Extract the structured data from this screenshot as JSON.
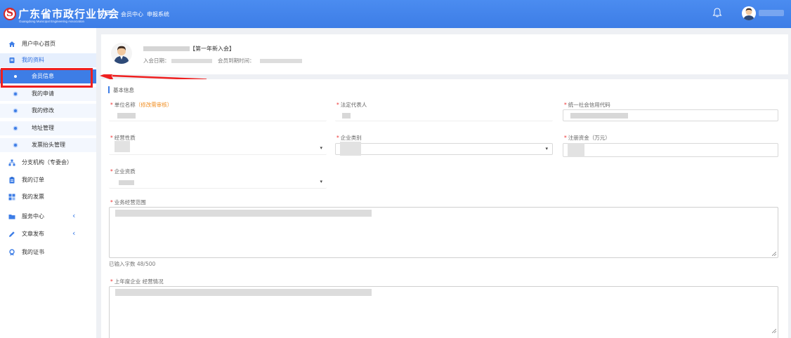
{
  "header": {
    "org_name": "广东省市政行业协会",
    "org_subtitle": "Guangdong Municipal Engineering Association",
    "menu_icon": "hamburger-icon",
    "nav": [
      "会员中心",
      "申报系统"
    ]
  },
  "sidebar": {
    "items": [
      {
        "label": "用户中心首页",
        "icon": "home-icon"
      },
      {
        "label": "我的资料",
        "icon": "profile-icon"
      },
      {
        "label": "会员信息",
        "icon": "dot-icon"
      },
      {
        "label": "我的申请",
        "icon": "dot-icon"
      },
      {
        "label": "我的修改",
        "icon": "dot-icon"
      },
      {
        "label": "地址管理",
        "icon": "dot-icon"
      },
      {
        "label": "发票抬头管理",
        "icon": "dot-icon"
      },
      {
        "label": "分支机构（专委会）",
        "icon": "org-tree-icon"
      },
      {
        "label": "我的订单",
        "icon": "order-icon"
      },
      {
        "label": "我的发票",
        "icon": "invoice-icon"
      },
      {
        "label": "服务中心",
        "icon": "folder-icon"
      },
      {
        "label": "文章发布",
        "icon": "pen-icon"
      },
      {
        "label": "我的证书",
        "icon": "certificate-icon"
      }
    ],
    "expand_arrow": "‹"
  },
  "profile": {
    "badge": "【第一年新入会】",
    "join_date_label": "入会日期：",
    "expire_label": "会员到期时间："
  },
  "form": {
    "section_title": "基本信息",
    "required_mark": "*",
    "fields": {
      "unit_name": {
        "label": "单位名称",
        "note": "（修改需审核）"
      },
      "legal_rep": {
        "label": "法定代表人"
      },
      "credit_code": {
        "label": "统一社会信用代码"
      },
      "nature": {
        "label": "经营性质"
      },
      "category": {
        "label": "企业类别"
      },
      "capital": {
        "label": "注册资金（万元）"
      },
      "qualification": {
        "label": "企业资质"
      },
      "business_scope": {
        "label": "业务经营范围"
      },
      "last_year": {
        "label": "上年度企业 经营情况"
      }
    },
    "char_count": "已输入字数 48/500",
    "select_caret": "▾"
  },
  "colors": {
    "brand": "#3d7de6",
    "highlight": "#ef1f1f",
    "required": "#e33333",
    "note": "#f08c1e"
  }
}
